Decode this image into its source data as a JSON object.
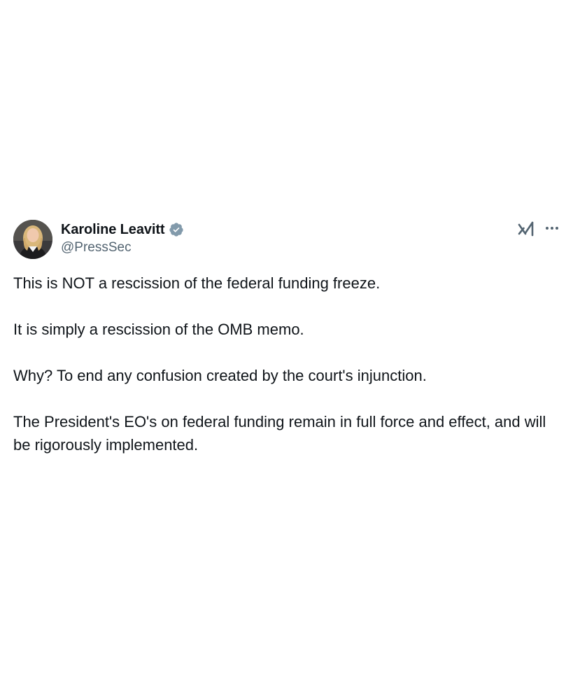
{
  "author": {
    "display_name": "Karoline Leavitt",
    "handle": "@PressSec",
    "verified_color": "#829aab"
  },
  "actions": {
    "grok_icon": "grok-icon",
    "more_icon": "more-horizontal-icon"
  },
  "tweet": {
    "paragraphs": [
      "This is NOT a rescission of the federal funding freeze.",
      "It is simply a rescission of the OMB memo.",
      "Why? To end any confusion created by the court's injunction.",
      "The President's EO's on federal funding remain in full force and effect, and will be rigorously implemented."
    ]
  },
  "colors": {
    "text": "#0f1419",
    "secondary_text": "#536471",
    "background": "#ffffff"
  }
}
